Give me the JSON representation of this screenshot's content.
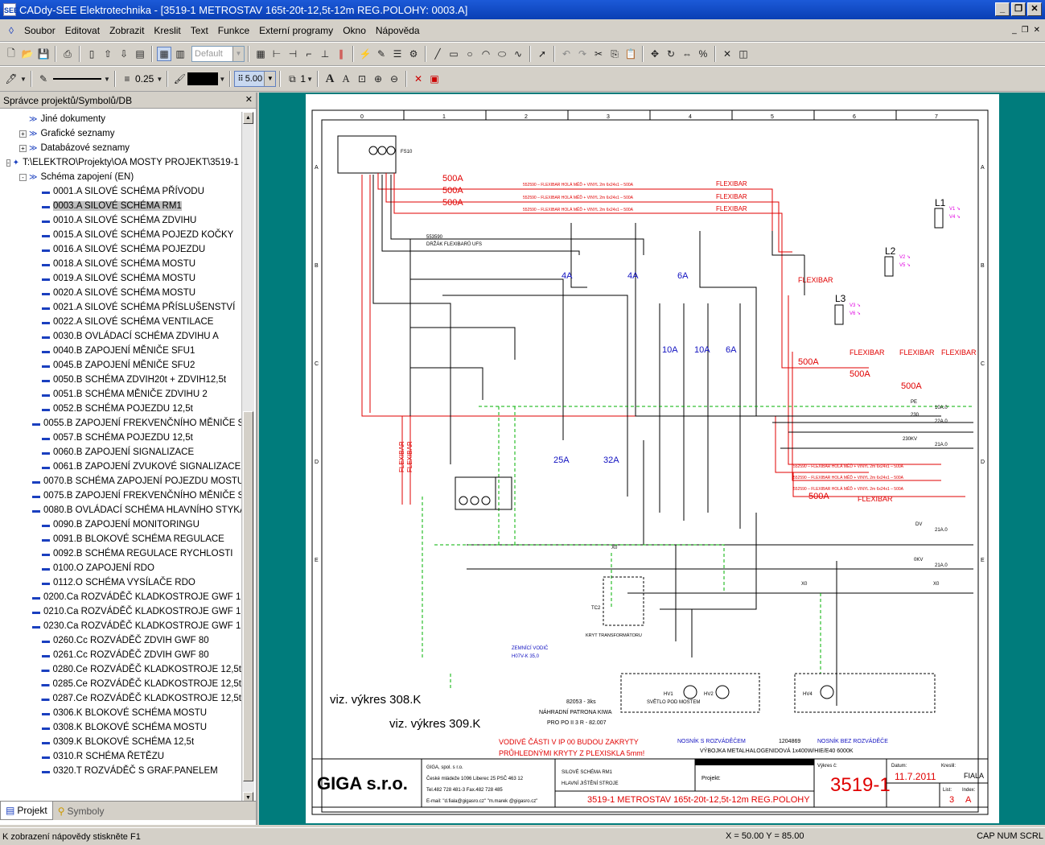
{
  "window": {
    "title": "CADdy-SEE Elektrotechnika - [3519-1 METROSTAV 165t-20t-12,5t-12m REG.POLOHY: 0003.A]",
    "app_icon": "SEE"
  },
  "menu": [
    "Soubor",
    "Editovat",
    "Zobrazit",
    "Kreslit",
    "Text",
    "Funkce",
    "Externí programy",
    "Okno",
    "Nápověda"
  ],
  "toolbar2": {
    "style_combo": "Default",
    "line_width": "0.25",
    "grid_value": "5.00",
    "layer_value": "1"
  },
  "panel": {
    "title": "Správce projektů/Symbolů/DB",
    "tree": [
      {
        "indent": 1,
        "label": "Jiné dokumenty",
        "exp": ""
      },
      {
        "indent": 1,
        "label": "Grafické seznamy",
        "exp": "+"
      },
      {
        "indent": 1,
        "label": "Databázové seznamy",
        "exp": "+"
      },
      {
        "indent": 0,
        "label": "T:\\ELEKTRO\\Projekty\\OA MOSTY PROJEKT\\3519-1 METROSTAV",
        "exp": "-"
      },
      {
        "indent": 1,
        "label": "Schéma zapojení (EN)",
        "exp": "-"
      },
      {
        "indent": 2,
        "label": "0001.A  SILOVÉ SCHÉMA PŘÍVODU",
        "exp": ""
      },
      {
        "indent": 2,
        "label": "0003.A  SILOVÉ SCHÉMA RM1",
        "exp": "",
        "selected": true
      },
      {
        "indent": 2,
        "label": "0010.A  SILOVÉ SCHÉMA ZDVIHU",
        "exp": ""
      },
      {
        "indent": 2,
        "label": "0015.A  SILOVÉ SCHÉMA POJEZD KOČKY",
        "exp": ""
      },
      {
        "indent": 2,
        "label": "0016.A  SILOVÉ SCHÉMA POJEZDU",
        "exp": ""
      },
      {
        "indent": 2,
        "label": "0018.A  SILOVÉ SCHÉMA MOSTU",
        "exp": ""
      },
      {
        "indent": 2,
        "label": "0019.A  SILOVÉ SCHÉMA MOSTU",
        "exp": ""
      },
      {
        "indent": 2,
        "label": "0020.A  SILOVÉ SCHÉMA MOSTU",
        "exp": ""
      },
      {
        "indent": 2,
        "label": "0021.A  SILOVÉ SCHÉMA PŘÍSLUŠENSTVÍ",
        "exp": ""
      },
      {
        "indent": 2,
        "label": "0022.A  SILOVÉ SCHÉMA VENTILACE",
        "exp": ""
      },
      {
        "indent": 2,
        "label": "0030.B  OVLÁDACÍ SCHÉMA ZDVIHU A",
        "exp": ""
      },
      {
        "indent": 2,
        "label": "0040.B  ZAPOJENÍ MĚNIČE SFU1",
        "exp": ""
      },
      {
        "indent": 2,
        "label": "0045.B  ZAPOJENÍ MĚNIČE SFU2",
        "exp": ""
      },
      {
        "indent": 2,
        "label": "0050.B  SCHÉMA ZDVIH20t + ZDVIH12,5t",
        "exp": ""
      },
      {
        "indent": 2,
        "label": "0051.B  SCHÉMA MĚNIČE ZDVIHU 2",
        "exp": ""
      },
      {
        "indent": 2,
        "label": "0052.B  SCHÉMA POJEZDU 12,5t",
        "exp": ""
      },
      {
        "indent": 2,
        "label": "0055.B  ZAPOJENÍ FREKVENČNÍHO MĚNIČE SFU4",
        "exp": ""
      },
      {
        "indent": 2,
        "label": "0057.B  SCHÉMA POJEZDU 12,5t",
        "exp": ""
      },
      {
        "indent": 2,
        "label": "0060.B  ZAPOJENÍ SIGNALIZACE",
        "exp": ""
      },
      {
        "indent": 2,
        "label": "0061.B  ZAPOJENÍ ZVUKOVÉ SIGNALIZACE",
        "exp": ""
      },
      {
        "indent": 2,
        "label": "0070.B  SCHÉMA ZAPOJENÍ POJEZDU MOSTU",
        "exp": ""
      },
      {
        "indent": 2,
        "label": "0075.B  ZAPOJENÍ FREKVENČNÍHO MĚNIČE SFU3",
        "exp": ""
      },
      {
        "indent": 2,
        "label": "0080.B  OVLÁDACÍ SCHÉMA HLAVNÍHO STYKAČE",
        "exp": ""
      },
      {
        "indent": 2,
        "label": "0090.B  ZAPOJENÍ MONITORINGU",
        "exp": ""
      },
      {
        "indent": 2,
        "label": "0091.B  BLOKOVÉ SCHÉMA REGULACE",
        "exp": ""
      },
      {
        "indent": 2,
        "label": "0092.B  SCHÉMA REGULACE RYCHLOSTI",
        "exp": ""
      },
      {
        "indent": 2,
        "label": "0100.O  ZAPOJENÍ RDO",
        "exp": ""
      },
      {
        "indent": 2,
        "label": "0112.O  SCHÉMA VYSÍLAČE RDO",
        "exp": ""
      },
      {
        "indent": 2,
        "label": "0200.Ca  ROZVÁDĚČ KLADKOSTROJE GWF 160",
        "exp": ""
      },
      {
        "indent": 2,
        "label": "0210.Ca  ROZVÁDĚČ KLADKOSTROJE GWF 160",
        "exp": ""
      },
      {
        "indent": 2,
        "label": "0230.Ca  ROZVÁDĚČ KLADKOSTROJE GWF 160",
        "exp": ""
      },
      {
        "indent": 2,
        "label": "0260.Cc  ROZVÁDĚČ ZDVIH GWF 80",
        "exp": ""
      },
      {
        "indent": 2,
        "label": "0261.Cc  ROZVÁDĚČ ZDVIH GWF 80",
        "exp": ""
      },
      {
        "indent": 2,
        "label": "0280.Ce  ROZVÁDĚČ KLADKOSTROJE 12,5t",
        "exp": ""
      },
      {
        "indent": 2,
        "label": "0285.Ce  ROZVÁDĚČ KLADKOSTROJE 12,5t",
        "exp": ""
      },
      {
        "indent": 2,
        "label": "0287.Ce  ROZVÁDĚČ KLADKOSTROJE 12,5t",
        "exp": ""
      },
      {
        "indent": 2,
        "label": "0306.K  BLOKOVÉ SCHÉMA MOSTU",
        "exp": ""
      },
      {
        "indent": 2,
        "label": "0308.K  BLOKOVÉ SCHÉMA MOSTU",
        "exp": ""
      },
      {
        "indent": 2,
        "label": "0309.K  BLOKOVÉ SCHÉMA 12,5t",
        "exp": ""
      },
      {
        "indent": 2,
        "label": "0310.R  SCHÉMA ŘETĚZU",
        "exp": ""
      },
      {
        "indent": 2,
        "label": "0320.T  ROZVÁDĚČ S GRAF.PANELEM",
        "exp": ""
      }
    ],
    "tabs": [
      "Projekt",
      "Symboly"
    ]
  },
  "drawing": {
    "columns": [
      "0",
      "1",
      "2",
      "3",
      "4",
      "5",
      "6",
      "7"
    ],
    "rows": [
      "A",
      "B",
      "C",
      "D",
      "E"
    ],
    "red_labels": [
      "500A",
      "500A",
      "500A",
      "500A",
      "500A",
      "500A",
      "500A"
    ],
    "flexibar": "FLEXIBAR",
    "flex_line": "552590 – FLEXIBAR HOLÁ MĚĎ + VINYL 2m 6x24x1 – 500A",
    "blue_amps": [
      "4A",
      "4A",
      "6A",
      "10A",
      "10A",
      "6A",
      "25A",
      "32A"
    ],
    "ref_left_1": "viz. výkres 308.K",
    "ref_left_2": "viz. výkres 309.K",
    "note_red_1": "VODIVÉ ČÁSTI V IP 00 BUDOU ZAKRYTY",
    "note_red_2": "PRŮHLEDNÝMI KRYTY Z PLEXISKLA 5mm!",
    "spare_1": "82053 - 3ks",
    "spare_2": "NÁHRADNÍ PATRONA KIWA",
    "spare_3": "PRO PO II 3 R - 82.007",
    "nosnik_1": "NOSNÍK S ROZVÁDĚČEM",
    "nosnik_2": "NOSNÍK BEZ ROZVÁDĚČE",
    "lamp_code": "1204869",
    "lamp_desc": "VÝBOJKA METALHALOGENIDOVÁ 1x400W/HIE/E40 6000K",
    "svetlo": "SVĚTLO POD MOSTEM",
    "zemnici": "ZEMNÍCÍ VODIČ",
    "zemnici_2": "H07V-K 35,0",
    "kryt": "KRYT TRANSFORMÁTORU",
    "drzak": "DRŽÁK FLEXIBARŮ UFS",
    "drzak_code": "553590",
    "supply": [
      "PE",
      "230",
      "230KV",
      "DV",
      "0KV",
      "X0"
    ],
    "supply_right": [
      "10A.0",
      "22A.0",
      "21A.0",
      "21A.0",
      "21A.0"
    ]
  },
  "titleblock": {
    "company": "GIGA s.r.o.",
    "address_1": "GIGA, spol. s r.o.",
    "address_2": "České mládeže 1096 Liberec 25 PSČ 463 12",
    "address_3": "Tel.482 728 481-3 Fax.482 728 485",
    "address_4": "E-mail: \"d.fiala@gigasro.cz\"   \"m.marek @gigasro.cz\"",
    "desc_1": "SILOVÉ SCHÉMA RM1",
    "desc_2": "HLAVNÍ JIŠTĚNÍ STROJE",
    "projekt_label": "Projekt:",
    "project_name": "3519-1 METROSTAV 165t-20t-12,5t-12m REG.POLOHY",
    "vykres_label": "Výkres č:",
    "vykres_value": "3519-1",
    "datum_label": "Datum:",
    "datum_value": "11.7.2011",
    "kreslil_label": "Kreslil:",
    "kreslil_value": "FIALA",
    "list_label": "List:",
    "list_value": "3",
    "index_label": "Index:",
    "index_value": "A"
  },
  "status": {
    "hint": "K zobrazení nápovědy stiskněte F1",
    "coords": "X = 50.00  Y = 85.00",
    "keys": "CAP NUM SCRL"
  },
  "colors": {
    "title_bar": "#0a3fb4",
    "canvas_bg": "#007c7c",
    "red_wire": "#e00000",
    "blue_text": "#1010c0",
    "green_pe": "#00b000",
    "magenta": "#e000e0"
  }
}
